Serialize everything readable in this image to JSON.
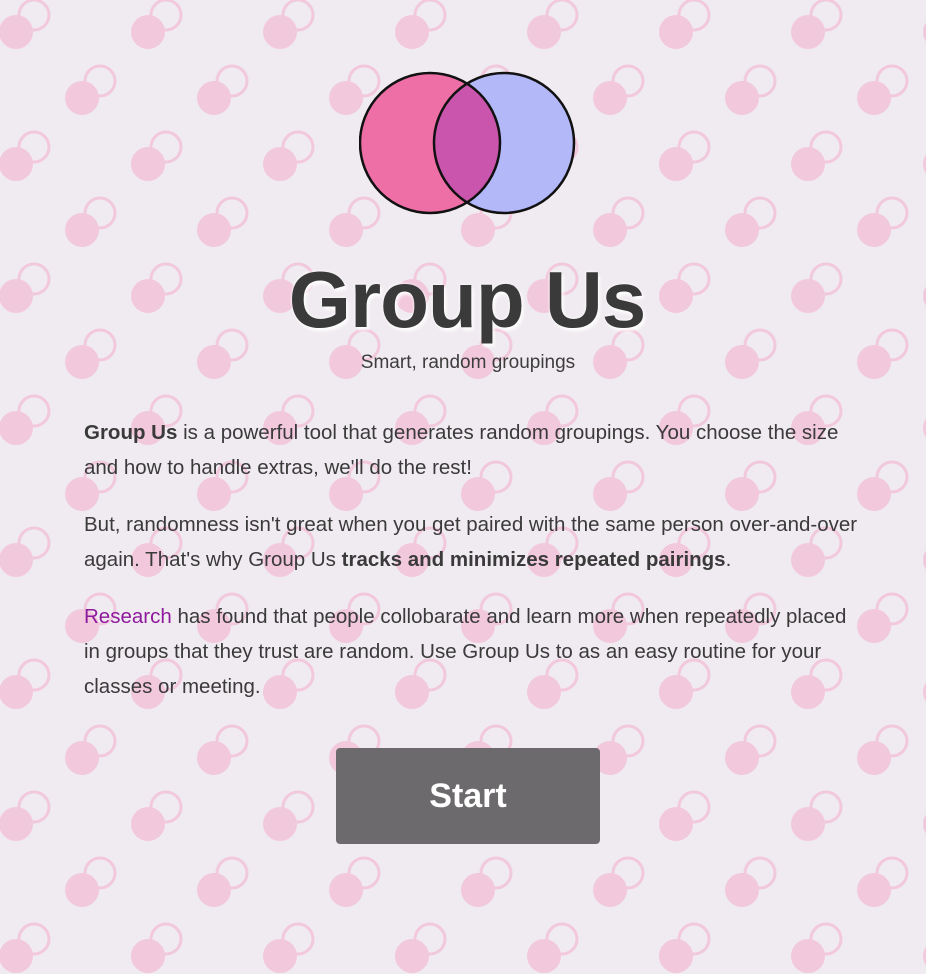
{
  "app": {
    "title": "Group Us",
    "subtitle": "Smart, random groupings"
  },
  "intro": {
    "p1_bold": "Group Us",
    "p1_rest": " is a powerful tool that generates random groupings. You choose the size and how to handle extras, we'll do the rest!",
    "p2_start": "But, randomness isn't great when you get paired with the same person over-and-over again. That's why Group Us ",
    "p2_bold": "tracks and minimizes repeated pairings",
    "p2_end": ".",
    "p3_link": "Research",
    "p3_rest": " has found that people collobarate and learn more when repeatedly placed in groups that they trust are random. Use Group Us to as an easy routine for your classes or meeting."
  },
  "actions": {
    "start_label": "Start"
  },
  "colors": {
    "background": "#f0ebf0",
    "pattern": "#f2c8dc",
    "logo_left": "#ee6fa6",
    "logo_right": "#b2b8f8",
    "logo_overlap": "#c955ad",
    "button": "#6d6a6e",
    "link": "#8e1a9c",
    "text": "#3a3a3a"
  }
}
